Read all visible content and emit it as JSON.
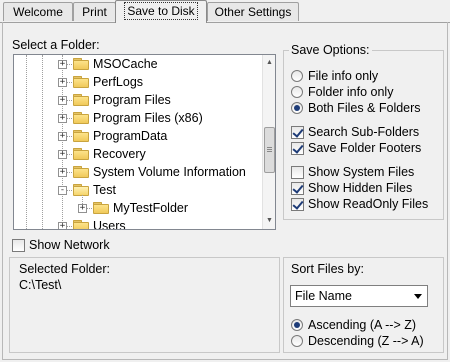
{
  "tabs": [
    {
      "label": "Welcome",
      "active": false
    },
    {
      "label": "Print",
      "active": false
    },
    {
      "label": "Save to Disk",
      "active": true
    },
    {
      "label": "Other Settings",
      "active": false
    }
  ],
  "folder_section": {
    "label": "Select a Folder:",
    "tree_items": [
      {
        "label": "MSOCache",
        "level": 2,
        "expander": "+",
        "open": false
      },
      {
        "label": "PerfLogs",
        "level": 2,
        "expander": "+",
        "open": false
      },
      {
        "label": "Program Files",
        "level": 2,
        "expander": "+",
        "open": false
      },
      {
        "label": "Program Files (x86)",
        "level": 2,
        "expander": "+",
        "open": false
      },
      {
        "label": "ProgramData",
        "level": 2,
        "expander": "+",
        "open": false
      },
      {
        "label": "Recovery",
        "level": 2,
        "expander": "+",
        "open": false
      },
      {
        "label": "System Volume Information",
        "level": 2,
        "expander": "+",
        "open": false
      },
      {
        "label": "Test",
        "level": 2,
        "expander": "-",
        "open": true
      },
      {
        "label": "MyTestFolder",
        "level": 3,
        "expander": "+",
        "open": false
      },
      {
        "label": "Users",
        "level": 2,
        "expander": "+",
        "open": false
      }
    ]
  },
  "show_network": {
    "label": "Show Network",
    "checked": false
  },
  "save_options": {
    "label": "Save Options:",
    "radios": [
      {
        "label": "File info only",
        "checked": false
      },
      {
        "label": "Folder info only",
        "checked": false
      },
      {
        "label": "Both Files & Folders",
        "checked": true
      }
    ],
    "checks_a": [
      {
        "label": "Search Sub-Folders",
        "checked": true
      },
      {
        "label": "Save Folder Footers",
        "checked": true
      }
    ],
    "checks_b": [
      {
        "label": "Show System Files",
        "checked": false
      },
      {
        "label": "Show Hidden Files",
        "checked": true
      },
      {
        "label": "Show ReadOnly Files",
        "checked": true
      }
    ]
  },
  "selected_folder": {
    "label": "Selected Folder:",
    "value": "C:\\Test\\"
  },
  "sort": {
    "label": "Sort Files by:",
    "selected": "File Name",
    "radios": [
      {
        "label": "Ascending (A --> Z)",
        "checked": true
      },
      {
        "label": "Descending (Z --> A)",
        "checked": false
      }
    ]
  }
}
